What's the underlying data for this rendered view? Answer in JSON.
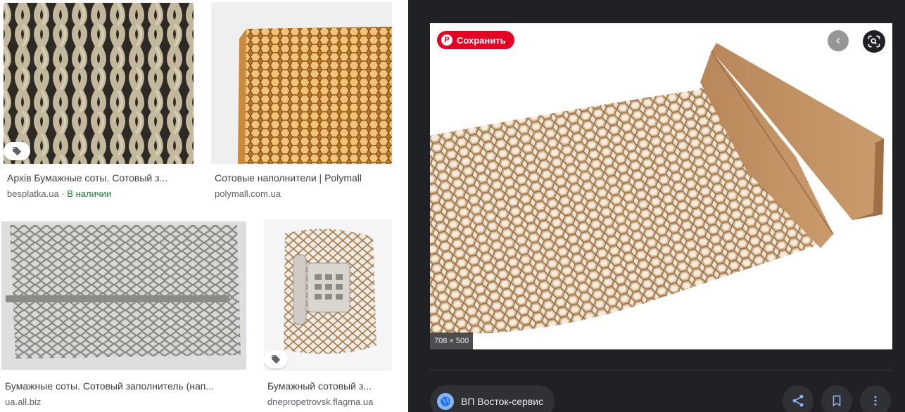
{
  "results": [
    {
      "caption": "Архів Бумажные соты. Сотовый з...",
      "source": "besplatka.ua",
      "availability": "В наличии",
      "has_tag": true
    },
    {
      "caption": "Сотовые наполнители | Polymall",
      "source": "polymall.com.ua",
      "has_tag": false
    },
    {
      "caption": "Бумажные соты. Сотовый заполнитель (нап...",
      "source": "ua.all.biz",
      "has_tag": false
    },
    {
      "caption": "Бумажный сотовый з...",
      "source": "dnepropetrovsk.flagma.ua",
      "has_tag": true
    }
  ],
  "separator": " · ",
  "preview": {
    "save_label": "Сохранить",
    "pin_glyph": "P",
    "dimensions": "708 × 500",
    "site_name": "ВП Восток-сервис"
  },
  "icons": {
    "tag": "tag-icon",
    "back": "chevron-left-icon",
    "lens": "lens-search-icon",
    "globe": "globe-icon",
    "share": "share-icon",
    "bookmark": "bookmark-icon",
    "more": "more-vert-icon"
  },
  "colors": {
    "panel_bg": "#202124",
    "pinterest_red": "#e60023",
    "in_stock_green": "#188038",
    "kraft": "#c9a47a"
  }
}
